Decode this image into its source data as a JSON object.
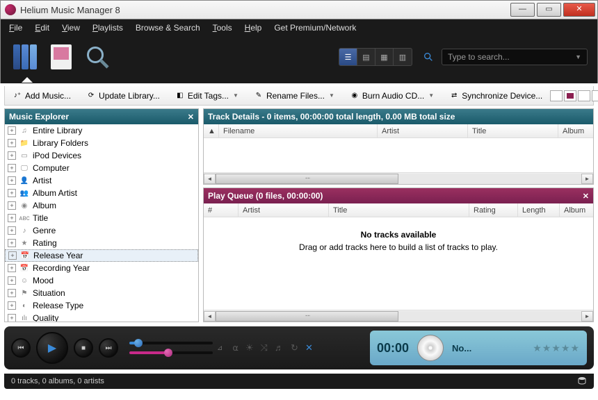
{
  "window": {
    "title": "Helium Music Manager 8"
  },
  "menu": {
    "file": "File",
    "edit": "Edit",
    "view": "View",
    "playlists": "Playlists",
    "browse": "Browse & Search",
    "tools": "Tools",
    "help": "Help",
    "premium": "Get Premium/Network"
  },
  "search": {
    "placeholder": "Type to search..."
  },
  "toolbar": {
    "addmusic": "Add Music...",
    "update": "Update Library...",
    "edittags": "Edit Tags...",
    "rename": "Rename Files...",
    "burn": "Burn Audio CD...",
    "sync": "Synchronize Device..."
  },
  "sidebar": {
    "title": "Music Explorer",
    "items": [
      {
        "label": "Entire Library",
        "sel": false
      },
      {
        "label": "Library Folders",
        "sel": false
      },
      {
        "label": "iPod Devices",
        "sel": false
      },
      {
        "label": "Computer",
        "sel": false
      },
      {
        "label": "Artist",
        "sel": false
      },
      {
        "label": "Album Artist",
        "sel": false
      },
      {
        "label": "Album",
        "sel": false
      },
      {
        "label": "Title",
        "sel": false
      },
      {
        "label": "Genre",
        "sel": false
      },
      {
        "label": "Rating",
        "sel": false
      },
      {
        "label": "Release Year",
        "sel": true
      },
      {
        "label": "Recording Year",
        "sel": false
      },
      {
        "label": "Mood",
        "sel": false
      },
      {
        "label": "Situation",
        "sel": false
      },
      {
        "label": "Release Type",
        "sel": false
      },
      {
        "label": "Quality",
        "sel": false
      }
    ]
  },
  "details": {
    "title": "Track Details - 0 items, 00:00:00 total length, 0.00 MB total size",
    "cols": {
      "filename": "Filename",
      "artist": "Artist",
      "title": "Title",
      "album": "Album"
    }
  },
  "queue": {
    "title": "Play Queue (0 files, 00:00:00)",
    "cols": {
      "num": "#",
      "artist": "Artist",
      "title": "Title",
      "rating": "Rating",
      "length": "Length",
      "album": "Album"
    },
    "empty_title": "No tracks available",
    "empty_sub": "Drag or add tracks here to build a list of tracks to play."
  },
  "player": {
    "time": "00:00",
    "title": "No..."
  },
  "status": {
    "text": "0 tracks, 0 albums, 0 artists"
  }
}
